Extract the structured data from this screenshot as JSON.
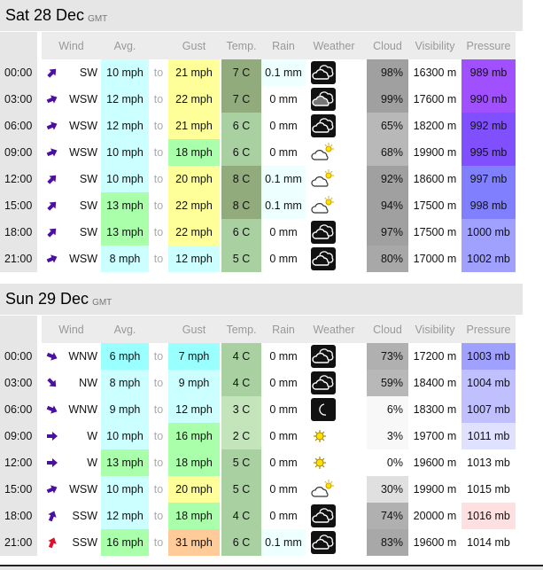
{
  "headers": {
    "wind": "Wind",
    "avg": "Avg.",
    "gust": "Gust",
    "temp": "Temp.",
    "rain": "Rain",
    "weather": "Weather",
    "cloud": "Cloud",
    "visibility": "Visibility",
    "pressure": "Pressure"
  },
  "days": [
    {
      "title": "Sat 28 Dec",
      "tz": "GMT",
      "rows": [
        {
          "time": "00:00",
          "dir": "SW",
          "arrow_deg": 225,
          "arrow_color": "#4b10a0",
          "avg": "10 mph",
          "avg_bg": "#ccffff",
          "to": "to",
          "gust": "21 mph",
          "gust_bg": "#ffff99",
          "temp": "7 C",
          "temp_bg": "#91ab7c",
          "rain": "0.1 mm",
          "rain_bg": "#eeffff",
          "weather_icon": "cloudy-icon",
          "cloud": "98%",
          "cloud_bg": "#a0a0a0",
          "vis": "16300 m",
          "pres": "989 mb",
          "pres_bg": "#a050ff"
        },
        {
          "time": "03:00",
          "dir": "WSW",
          "arrow_deg": 247,
          "arrow_color": "#4b10a0",
          "avg": "12 mph",
          "avg_bg": "#ccffff",
          "to": "to",
          "gust": "22 mph",
          "gust_bg": "#ffff99",
          "temp": "7 C",
          "temp_bg": "#91ab7c",
          "rain": "0 mm",
          "rain_bg": "#ffffff",
          "weather_icon": "overcast-icon",
          "cloud": "99%",
          "cloud_bg": "#a0a0a0",
          "vis": "17600 m",
          "pres": "990 mb",
          "pres_bg": "#a050ff"
        },
        {
          "time": "06:00",
          "dir": "WSW",
          "arrow_deg": 247,
          "arrow_color": "#4b10a0",
          "avg": "12 mph",
          "avg_bg": "#ccffff",
          "to": "to",
          "gust": "21 mph",
          "gust_bg": "#ffff99",
          "temp": "6 C",
          "temp_bg": "#a8d0a0",
          "rain": "0 mm",
          "rain_bg": "#ffffff",
          "weather_icon": "cloudy-icon",
          "cloud": "65%",
          "cloud_bg": "#b8b8b8",
          "vis": "18200 m",
          "pres": "992 mb",
          "pres_bg": "#8050ff"
        },
        {
          "time": "09:00",
          "dir": "WSW",
          "arrow_deg": 247,
          "arrow_color": "#4b10a0",
          "avg": "10 mph",
          "avg_bg": "#ccffff",
          "to": "to",
          "gust": "18 mph",
          "gust_bg": "#aaffaa",
          "temp": "6 C",
          "temp_bg": "#a8d0a0",
          "rain": "0 mm",
          "rain_bg": "#ffffff",
          "weather_icon": "partly-cloudy-day-icon",
          "cloud": "68%",
          "cloud_bg": "#b8b8b8",
          "vis": "19900 m",
          "pres": "995 mb",
          "pres_bg": "#8050ff"
        },
        {
          "time": "12:00",
          "dir": "SW",
          "arrow_deg": 225,
          "arrow_color": "#4b10a0",
          "avg": "10 mph",
          "avg_bg": "#ccffff",
          "to": "to",
          "gust": "20 mph",
          "gust_bg": "#ffff99",
          "temp": "8 C",
          "temp_bg": "#91ab7c",
          "rain": "0.1 mm",
          "rain_bg": "#eeffff",
          "weather_icon": "partly-cloudy-day-icon",
          "cloud": "92%",
          "cloud_bg": "#a0a0a0",
          "vis": "18600 m",
          "pres": "997 mb",
          "pres_bg": "#8080ff"
        },
        {
          "time": "15:00",
          "dir": "SW",
          "arrow_deg": 225,
          "arrow_color": "#4b10a0",
          "avg": "13 mph",
          "avg_bg": "#aaffaa",
          "to": "to",
          "gust": "22 mph",
          "gust_bg": "#ffff99",
          "temp": "8 C",
          "temp_bg": "#91ab7c",
          "rain": "0.1 mm",
          "rain_bg": "#eeffff",
          "weather_icon": "partly-cloudy-day-icon",
          "cloud": "94%",
          "cloud_bg": "#a0a0a0",
          "vis": "17500 m",
          "pres": "998 mb",
          "pres_bg": "#8080ff"
        },
        {
          "time": "18:00",
          "dir": "SW",
          "arrow_deg": 225,
          "arrow_color": "#4b10a0",
          "avg": "13 mph",
          "avg_bg": "#aaffaa",
          "to": "to",
          "gust": "22 mph",
          "gust_bg": "#ffff99",
          "temp": "6 C",
          "temp_bg": "#a8d0a0",
          "rain": "0 mm",
          "rain_bg": "#ffffff",
          "weather_icon": "cloudy-icon",
          "cloud": "97%",
          "cloud_bg": "#a0a0a0",
          "vis": "17500 m",
          "pres": "1000 mb",
          "pres_bg": "#a0a0ff"
        },
        {
          "time": "21:00",
          "dir": "WSW",
          "arrow_deg": 247,
          "arrow_color": "#4b10a0",
          "avg": "8 mph",
          "avg_bg": "#ccffff",
          "to": "to",
          "gust": "12 mph",
          "gust_bg": "#ccffff",
          "temp": "5 C",
          "temp_bg": "#a8d0a0",
          "rain": "0 mm",
          "rain_bg": "#ffffff",
          "weather_icon": "cloudy-icon",
          "cloud": "80%",
          "cloud_bg": "#a8a8a8",
          "vis": "17000 m",
          "pres": "1002 mb",
          "pres_bg": "#a0a0ff"
        }
      ]
    },
    {
      "title": "Sun 29 Dec",
      "tz": "GMT",
      "rows": [
        {
          "time": "00:00",
          "dir": "WNW",
          "arrow_deg": 292,
          "arrow_color": "#4b10a0",
          "avg": "6 mph",
          "avg_bg": "#99ffff",
          "to": "to",
          "gust": "7 mph",
          "gust_bg": "#99ffff",
          "temp": "4 C",
          "temp_bg": "#a8d0a0",
          "rain": "0 mm",
          "rain_bg": "#ffffff",
          "weather_icon": "cloudy-icon",
          "cloud": "73%",
          "cloud_bg": "#b0b0b0",
          "vis": "17200 m",
          "pres": "1003 mb",
          "pres_bg": "#a0a0ff"
        },
        {
          "time": "03:00",
          "dir": "NW",
          "arrow_deg": 315,
          "arrow_color": "#4b10a0",
          "avg": "8 mph",
          "avg_bg": "#ccffff",
          "to": "to",
          "gust": "9 mph",
          "gust_bg": "#ccffff",
          "temp": "4 C",
          "temp_bg": "#a8d0a0",
          "rain": "0 mm",
          "rain_bg": "#ffffff",
          "weather_icon": "cloudy-icon",
          "cloud": "59%",
          "cloud_bg": "#b8b8b8",
          "vis": "18400 m",
          "pres": "1004 mb",
          "pres_bg": "#c0c0ff"
        },
        {
          "time": "06:00",
          "dir": "WNW",
          "arrow_deg": 292,
          "arrow_color": "#4b10a0",
          "avg": "9 mph",
          "avg_bg": "#ccffff",
          "to": "to",
          "gust": "12 mph",
          "gust_bg": "#ccffff",
          "temp": "3 C",
          "temp_bg": "#c4e4bc",
          "rain": "0 mm",
          "rain_bg": "#ffffff",
          "weather_icon": "clear-night-icon",
          "cloud": "6%",
          "cloud_bg": "#f8f8f8",
          "vis": "18300 m",
          "pres": "1007 mb",
          "pres_bg": "#c0c0ff"
        },
        {
          "time": "09:00",
          "dir": "W",
          "arrow_deg": 270,
          "arrow_color": "#4b10a0",
          "avg": "10 mph",
          "avg_bg": "#ccffff",
          "to": "to",
          "gust": "16 mph",
          "gust_bg": "#aaffaa",
          "temp": "2 C",
          "temp_bg": "#c4e4bc",
          "rain": "0 mm",
          "rain_bg": "#ffffff",
          "weather_icon": "sunny-icon",
          "cloud": "3%",
          "cloud_bg": "#f8f8f8",
          "vis": "19700 m",
          "pres": "1011 mb",
          "pres_bg": "#e0e0ff"
        },
        {
          "time": "12:00",
          "dir": "W",
          "arrow_deg": 270,
          "arrow_color": "#4b10a0",
          "avg": "13 mph",
          "avg_bg": "#aaffaa",
          "to": "to",
          "gust": "18 mph",
          "gust_bg": "#aaffaa",
          "temp": "5 C",
          "temp_bg": "#a8d0a0",
          "rain": "0 mm",
          "rain_bg": "#ffffff",
          "weather_icon": "sunny-icon",
          "cloud": "0%",
          "cloud_bg": "#ffffff",
          "vis": "19600 m",
          "pres": "1013 mb",
          "pres_bg": "#ffffff"
        },
        {
          "time": "15:00",
          "dir": "WSW",
          "arrow_deg": 247,
          "arrow_color": "#4b10a0",
          "avg": "10 mph",
          "avg_bg": "#ccffff",
          "to": "to",
          "gust": "20 mph",
          "gust_bg": "#ffff99",
          "temp": "5 C",
          "temp_bg": "#a8d0a0",
          "rain": "0 mm",
          "rain_bg": "#ffffff",
          "weather_icon": "partly-cloudy-day-icon",
          "cloud": "30%",
          "cloud_bg": "#e0e0e0",
          "vis": "19900 m",
          "pres": "1015 mb",
          "pres_bg": "#ffffff"
        },
        {
          "time": "18:00",
          "dir": "SSW",
          "arrow_deg": 202,
          "arrow_color": "#4b10a0",
          "avg": "12 mph",
          "avg_bg": "#ccffff",
          "to": "to",
          "gust": "18 mph",
          "gust_bg": "#aaffaa",
          "temp": "4 C",
          "temp_bg": "#a8d0a0",
          "rain": "0 mm",
          "rain_bg": "#ffffff",
          "weather_icon": "cloudy-icon",
          "cloud": "74%",
          "cloud_bg": "#b0b0b0",
          "vis": "20000 m",
          "pres": "1016 mb",
          "pres_bg": "#ffe0e0"
        },
        {
          "time": "21:00",
          "dir": "SSW",
          "arrow_deg": 202,
          "arrow_color": "#e0102a",
          "avg": "16 mph",
          "avg_bg": "#aaffaa",
          "to": "to",
          "gust": "31 mph",
          "gust_bg": "#ffcc99",
          "temp": "6 C",
          "temp_bg": "#a8d0a0",
          "rain": "0.1 mm",
          "rain_bg": "#eeffff",
          "weather_icon": "cloudy-icon",
          "cloud": "83%",
          "cloud_bg": "#a8a8a8",
          "vis": "19600 m",
          "pres": "1014 mb",
          "pres_bg": "#ffffff"
        }
      ]
    }
  ]
}
